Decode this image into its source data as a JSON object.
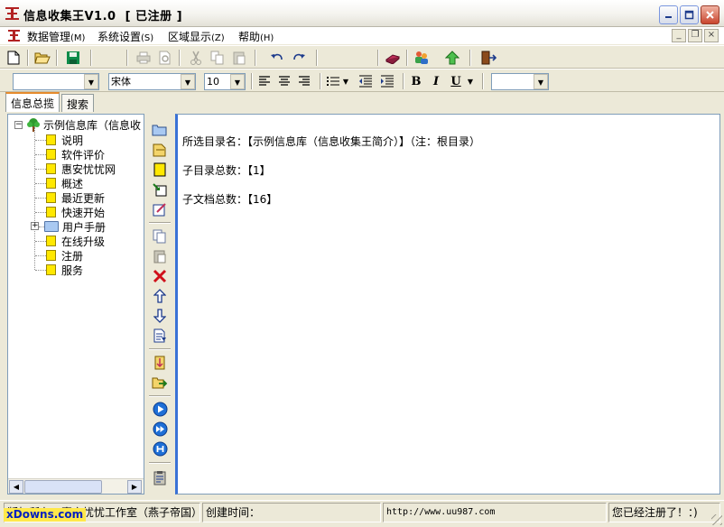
{
  "window": {
    "title": "信息收集王V1.0  [ 已注册 ]",
    "accent": "#b22222"
  },
  "menu": {
    "items": [
      {
        "label": "数据管理",
        "accel": "(M)"
      },
      {
        "label": "系统设置",
        "accel": "(S)"
      },
      {
        "label": "区域显示",
        "accel": "(Z)"
      },
      {
        "label": "帮助",
        "accel": "(H)"
      }
    ]
  },
  "format_toolbar": {
    "style_value": "",
    "font_value": "宋体",
    "size_value": "10",
    "color_value": ""
  },
  "tabs": [
    {
      "label": "信息总揽",
      "active": true
    },
    {
      "label": "搜索",
      "active": false
    }
  ],
  "tree": {
    "root": "示例信息库（信息收",
    "items": [
      {
        "label": "说明",
        "type": "note"
      },
      {
        "label": "软件评价",
        "type": "note"
      },
      {
        "label": "惠安忧忧网",
        "type": "note"
      },
      {
        "label": "概述",
        "type": "note"
      },
      {
        "label": "最近更新",
        "type": "note"
      },
      {
        "label": "快速开始",
        "type": "note"
      },
      {
        "label": "用户手册",
        "type": "folder"
      },
      {
        "label": "在线升级",
        "type": "note"
      },
      {
        "label": "注册",
        "type": "note"
      },
      {
        "label": "服务",
        "type": "note"
      }
    ]
  },
  "content": {
    "lines": [
      "所选目录名：【示例信息库（信息收集王简介）】（注：根目录）",
      "子目录总数：【1】",
      "子文档总数：【16】"
    ]
  },
  "status": {
    "panel1": "版权所有：惠安忧忧工作室（燕子帝国）",
    "panel2": "创建时间：",
    "panel3": "http://www.uu987.com",
    "panel4": "您已经注册了！：)"
  },
  "watermark": "xDowns.com",
  "icons": {
    "new": "new-document-icon",
    "open": "open-folder-icon",
    "save": "save-disk-icon",
    "print": "print-icon",
    "preview": "print-preview-icon",
    "cut": "cut-icon",
    "copy": "copy-icon",
    "paste": "paste-icon",
    "undo": "undo-icon",
    "redo": "redo-icon",
    "book": "book-icon",
    "users": "users-icon",
    "home": "home-up-icon",
    "exit": "exit-door-icon"
  }
}
